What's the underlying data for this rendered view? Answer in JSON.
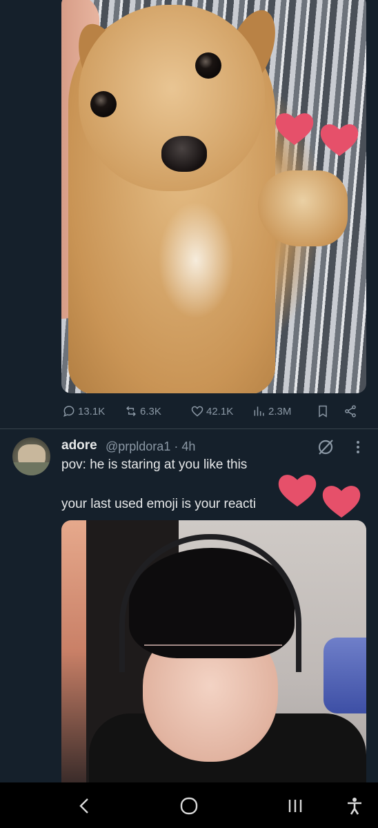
{
  "post1": {
    "actions": {
      "replies": "13.1K",
      "reposts": "6.3K",
      "likes": "42.1K",
      "views": "2.3M"
    }
  },
  "post2": {
    "display_name": "adore",
    "handle_time": "@prpldora1 · 4h",
    "line1": "pov: he is staring at you like this",
    "line2": "your last used emoji is your reacti"
  },
  "colors": {
    "background": "#15202b",
    "text": "#e7e9ea",
    "muted": "#8b98a5",
    "heart": "#e6506a"
  },
  "icons": {
    "reply": "speech-bubble-icon",
    "repost": "repost-icon",
    "like": "heart-icon",
    "views": "bar-chart-icon",
    "bookmark": "bookmark-icon",
    "share": "share-icon",
    "grok": "grok-icon",
    "more": "more-vertical-icon",
    "nav_back": "chevron-left-icon",
    "nav_home": "home-circle-icon",
    "nav_recents": "recents-icon",
    "nav_accessibility": "accessibility-icon"
  }
}
